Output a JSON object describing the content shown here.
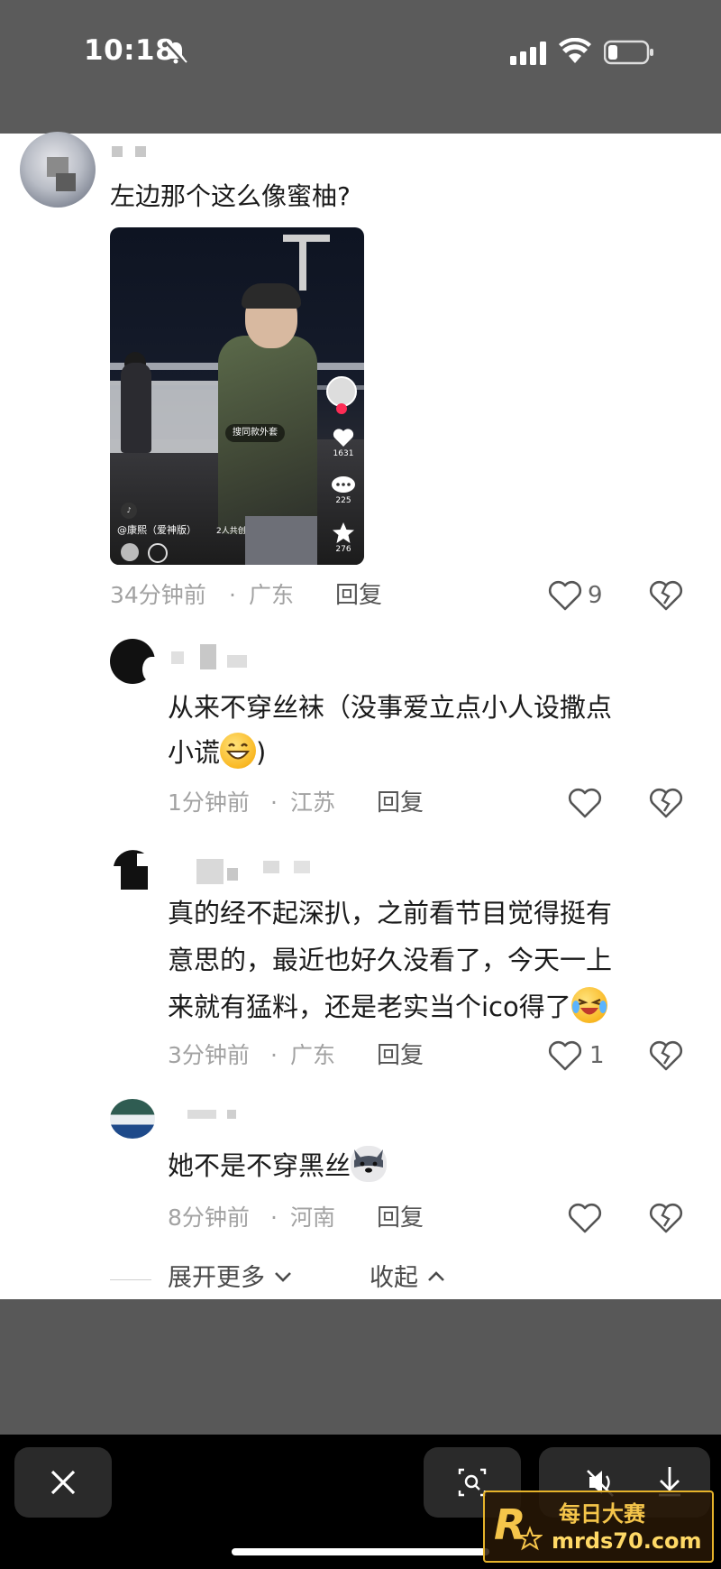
{
  "status_bar": {
    "time": "10:18"
  },
  "comment": {
    "text": "左边那个这么像蜜柚?",
    "time": "34分钟前",
    "location": "广东",
    "reply_label": "回复",
    "like_count": "9",
    "video": {
      "search_pill": "搜同款外套",
      "author": "@康熙（爱神版）",
      "coop": "2人共创",
      "like_count": "1631",
      "comment_count": "225",
      "fav_count": "276"
    }
  },
  "replies": [
    {
      "text_line1": "从来不穿丝袜（没事爱立点小人设撒点",
      "text_line2": "小谎",
      "text_tail": ")",
      "emoji": "grin-emoji",
      "time": "1分钟前",
      "location": "江苏",
      "reply_label": "回复",
      "like_count": ""
    },
    {
      "text_line1": "真的经不起深扒，之前看节目觉得挺有",
      "text_line2": "意思的，最近也好久没看了，今天一上",
      "text_line3": "来就有猛料，还是老实当个ico得了",
      "emoji": "laugh-cry-emoji",
      "time": "3分钟前",
      "location": "广东",
      "reply_label": "回复",
      "like_count": "1"
    },
    {
      "text_line1": "她不是不穿黑丝",
      "emoji": "husky-emoji",
      "time": "8分钟前",
      "location": "河南",
      "reply_label": "回复",
      "like_count": ""
    }
  ],
  "expand_label": "展开更多",
  "collapse_label": "收起",
  "watermark": {
    "line1": "每日大赛",
    "line2": "mrds70.com",
    "letter": "R"
  },
  "colors": {
    "accent_red": "#fe2c55",
    "watermark_gold": "#e6b32a"
  }
}
